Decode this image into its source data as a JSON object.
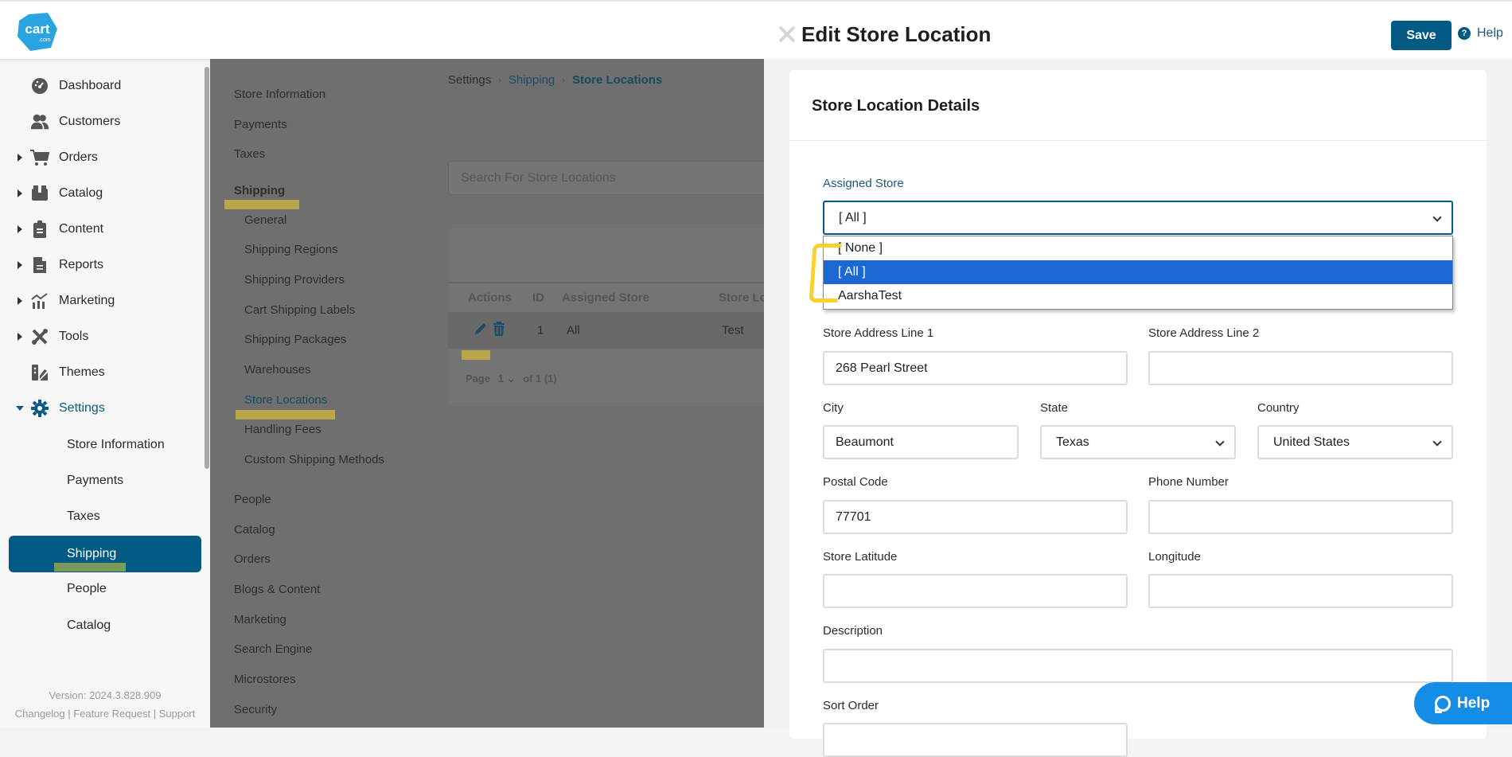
{
  "app": {
    "logo_text": "cart",
    "logo_sub": ".com",
    "brand_color": "#2aa5e0",
    "accent_color": "#005a84"
  },
  "sidebar": {
    "items": [
      {
        "label": "Dashboard",
        "icon": "dashboard-icon",
        "expandable": false
      },
      {
        "label": "Customers",
        "icon": "customers-icon",
        "expandable": false
      },
      {
        "label": "Orders",
        "icon": "cart-icon",
        "expandable": true
      },
      {
        "label": "Catalog",
        "icon": "catalog-box-icon",
        "expandable": true
      },
      {
        "label": "Content",
        "icon": "clipboard-icon",
        "expandable": true
      },
      {
        "label": "Reports",
        "icon": "report-file-icon",
        "expandable": true
      },
      {
        "label": "Marketing",
        "icon": "chart-icon",
        "expandable": true
      },
      {
        "label": "Tools",
        "icon": "tools-icon",
        "expandable": true
      },
      {
        "label": "Themes",
        "icon": "themes-icon",
        "expandable": false
      },
      {
        "label": "Settings",
        "icon": "gear-icon",
        "expandable": true,
        "expanded": true
      }
    ],
    "settings_sub": [
      {
        "label": "Store Information"
      },
      {
        "label": "Payments"
      },
      {
        "label": "Taxes"
      },
      {
        "label": "Shipping",
        "active": true
      },
      {
        "label": "People"
      },
      {
        "label": "Catalog"
      }
    ],
    "version": "Version: 2024.3.828.909",
    "footer_links": [
      "Changelog",
      "Feature Request",
      "Support"
    ]
  },
  "settings_nav": {
    "top": [
      "Store Information",
      "Payments",
      "Taxes"
    ],
    "shipping_heading": "Shipping",
    "shipping_sub": [
      "General",
      "Shipping Regions",
      "Shipping Providers",
      "Cart Shipping Labels",
      "Shipping Packages",
      "Warehouses",
      "Store Locations",
      "Handling Fees",
      "Custom Shipping Methods"
    ],
    "current": "Store Locations",
    "bottom": [
      "People",
      "Catalog",
      "Orders",
      "Blogs & Content",
      "Marketing",
      "Search Engine",
      "Microstores",
      "Security"
    ]
  },
  "breadcrumb": [
    "Settings",
    "Shipping",
    "Store Locations"
  ],
  "list": {
    "search_placeholder": "Search For Store Locations",
    "columns": [
      "Actions",
      "ID",
      "Assigned Store",
      "Store Lo"
    ],
    "rows": [
      {
        "id": "1",
        "assigned_store": "All",
        "store_location": "Test"
      }
    ],
    "pager": {
      "label": "Page",
      "page": "1",
      "of": "of 1 (1)"
    }
  },
  "panel": {
    "title": "Edit Store Location",
    "save_label": "Save",
    "help_label": "Help",
    "card_title": "Store Location Details",
    "assigned_store": {
      "label": "Assigned Store",
      "value": "[ All ]",
      "options": [
        "[ None ]",
        "[ All ]",
        "AarshaTest"
      ],
      "selected_index": 1
    },
    "fields": {
      "address1": {
        "label": "Store Address Line 1",
        "value": "268 Pearl Street"
      },
      "address2": {
        "label": "Store Address Line 2",
        "value": ""
      },
      "city": {
        "label": "City",
        "value": "Beaumont"
      },
      "state": {
        "label": "State",
        "value": "Texas"
      },
      "country": {
        "label": "Country",
        "value": "United States"
      },
      "postal": {
        "label": "Postal Code",
        "value": "77701"
      },
      "phone": {
        "label": "Phone Number",
        "value": ""
      },
      "latitude": {
        "label": "Store Latitude",
        "value": ""
      },
      "longitude": {
        "label": "Longitude",
        "value": ""
      },
      "description": {
        "label": "Description",
        "value": ""
      },
      "sort_order": {
        "label": "Sort Order",
        "value": ""
      }
    }
  },
  "chat_help_label": "Help"
}
